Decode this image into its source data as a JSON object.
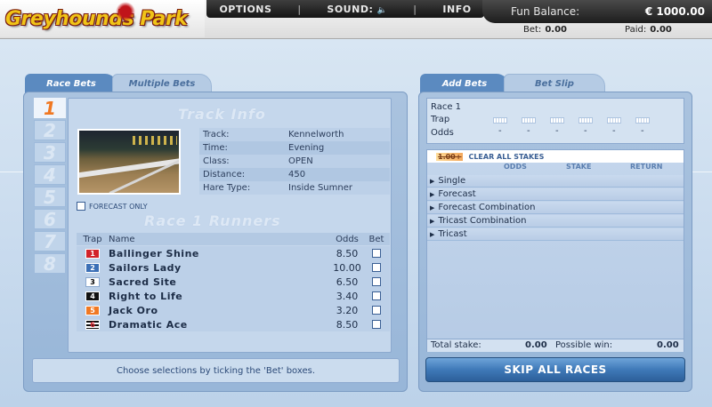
{
  "app": {
    "logo_text": "Greyhounds Park"
  },
  "menu": {
    "options": "OPTIONS",
    "sound": "SOUND:",
    "sound_icon": "🔈",
    "info": "INFO",
    "sep": "|"
  },
  "balance": {
    "label": "Fun Balance:",
    "amount": "€ 1000.00",
    "bet_label": "Bet:",
    "bet_value": "0.00",
    "paid_label": "Paid:",
    "paid_value": "0.00"
  },
  "left_tabs": {
    "race_bets": "Race Bets",
    "multiple_bets": "Multiple Bets"
  },
  "race_numbers": [
    "1",
    "2",
    "3",
    "4",
    "5",
    "6",
    "7",
    "8"
  ],
  "track_info": {
    "title": "Track Info",
    "rows": [
      {
        "k": "Track:",
        "v": "Kennelworth"
      },
      {
        "k": "Time:",
        "v": "Evening"
      },
      {
        "k": "Class:",
        "v": "OPEN"
      },
      {
        "k": "Distance:",
        "v": "450"
      },
      {
        "k": "Hare Type:",
        "v": "Inside Sumner"
      }
    ]
  },
  "forecast_only": "FORECAST ONLY",
  "runners": {
    "title": "Race 1 Runners",
    "headers": {
      "trap": "Trap",
      "name": "Name",
      "odds": "Odds",
      "bet": "Bet"
    },
    "rows": [
      {
        "trap": "1",
        "name": "Ballinger Shine",
        "odds": "8.50",
        "color": "#d2232a",
        "text": "#ffffff"
      },
      {
        "trap": "2",
        "name": "Sailors Lady",
        "odds": "10.00",
        "color": "#3b6fb6",
        "text": "#ffffff"
      },
      {
        "trap": "3",
        "name": "Sacred Site",
        "odds": "6.50",
        "color": "#ffffff",
        "text": "#000000"
      },
      {
        "trap": "4",
        "name": "Right to Life",
        "odds": "3.40",
        "color": "#111111",
        "text": "#ffffff"
      },
      {
        "trap": "5",
        "name": "Jack Oro",
        "odds": "3.20",
        "color": "#f07822",
        "text": "#ffffff"
      },
      {
        "trap": "6",
        "name": "Dramatic Ace",
        "odds": "8.50",
        "color": "striped",
        "text": "#d2232a"
      }
    ]
  },
  "hint": "Choose selections by ticking the 'Bet' boxes.",
  "right_tabs": {
    "add_bets": "Add Bets",
    "bet_slip": "Bet Slip"
  },
  "race_box": {
    "race": "Race 1",
    "trap": "Trap",
    "odds": "Odds",
    "dash": "-"
  },
  "stakes": {
    "stake_value": "1.00+",
    "clear_all": "CLEAR ALL STAKES",
    "col_odds": "ODDS",
    "col_stake": "STAKE",
    "col_return": "RETURN"
  },
  "bet_types": [
    "Single",
    "Forecast",
    "Forecast Combination",
    "Tricast Combination",
    "Tricast"
  ],
  "totals": {
    "total_label": "Total stake:",
    "total_value": "0.00",
    "win_label": "Possible win:",
    "win_value": "0.00"
  },
  "skip_button": "SKIP ALL RACES"
}
